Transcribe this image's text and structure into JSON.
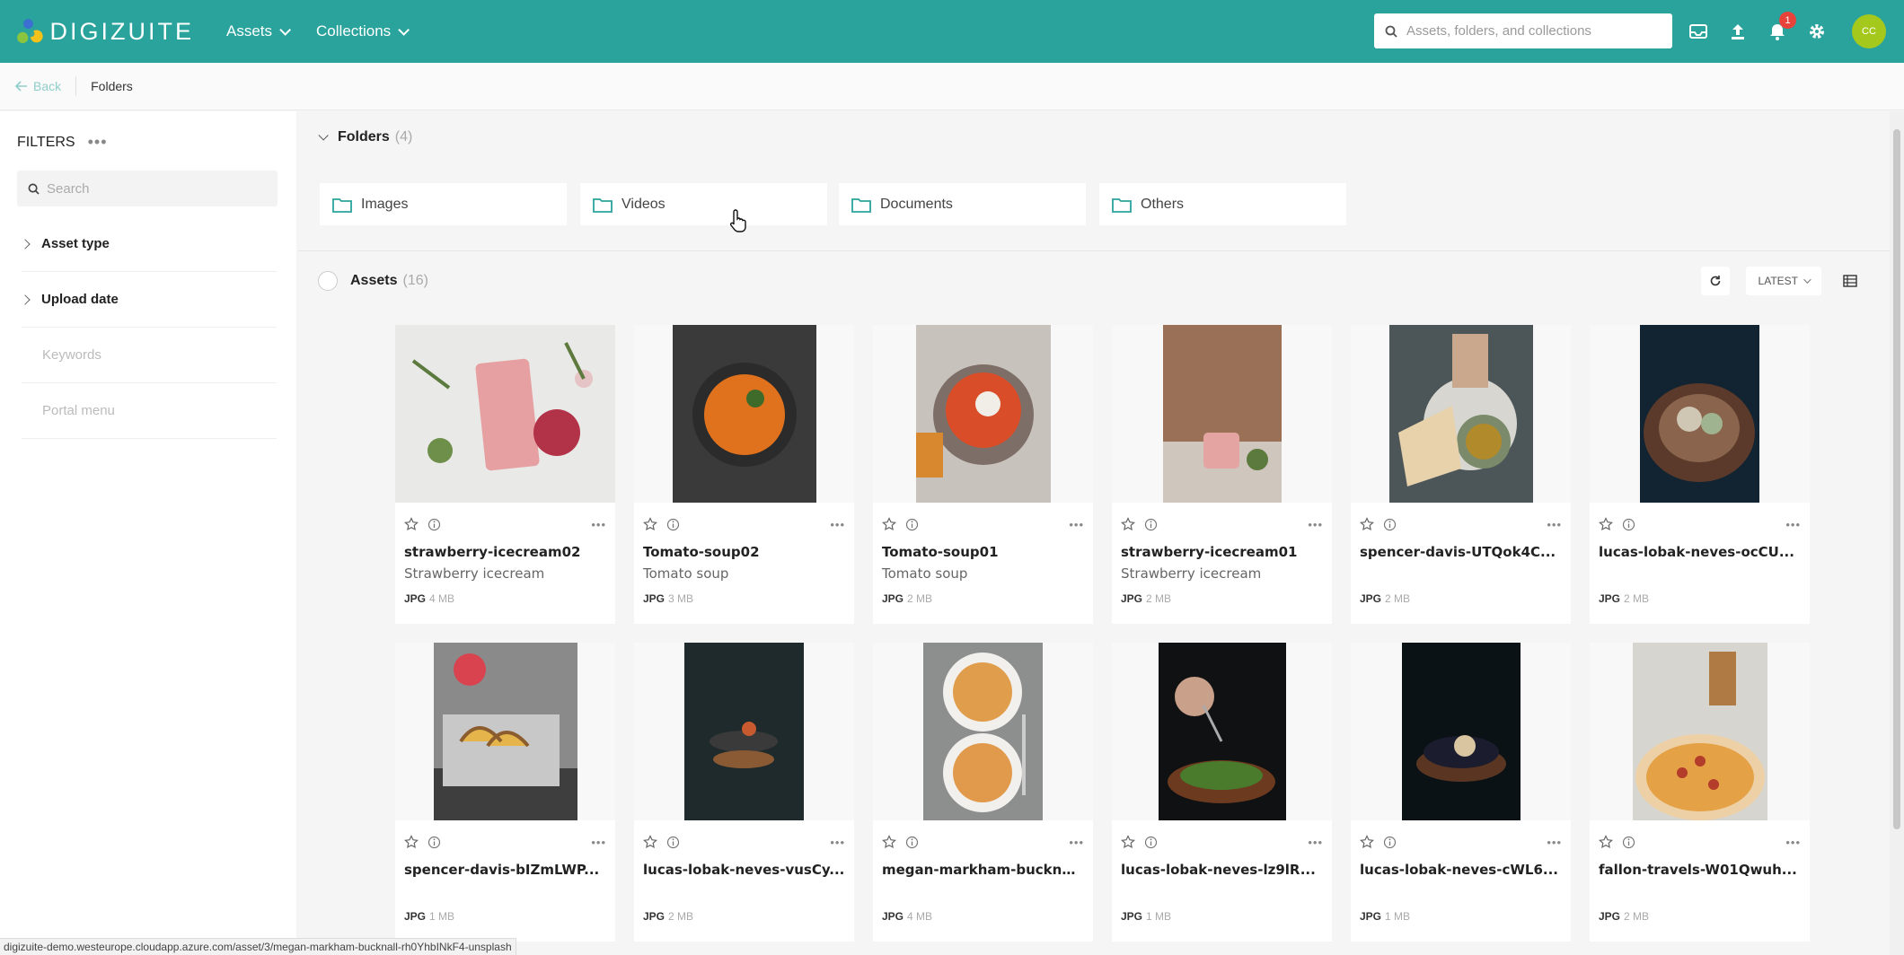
{
  "header": {
    "brand": "DIGIZUITE",
    "nav": [
      {
        "label": "Assets"
      },
      {
        "label": "Collections"
      }
    ],
    "search_placeholder": "Assets, folders, and collections",
    "notification_count": "1",
    "avatar_initials": "CC",
    "accent_color": "#2aa39c"
  },
  "breadcrumb": {
    "back_label": "Back",
    "current": "Folders"
  },
  "sidebar": {
    "title": "FILTERS",
    "search_placeholder": "Search",
    "facets": [
      {
        "label": "Asset type"
      },
      {
        "label": "Upload date"
      },
      {
        "label": "Keywords"
      },
      {
        "label": "Portal menu"
      }
    ]
  },
  "folders": {
    "title": "Folders",
    "count": "(4)",
    "items": [
      {
        "label": "Images"
      },
      {
        "label": "Videos"
      },
      {
        "label": "Documents"
      },
      {
        "label": "Others"
      }
    ]
  },
  "assets": {
    "title": "Assets",
    "count": "(16)",
    "sort_label": "LATEST",
    "items": [
      {
        "title": "strawberry-icecream02",
        "subtitle": "Strawberry icecream",
        "format": "JPG",
        "size": "4 MB"
      },
      {
        "title": "Tomato-soup02",
        "subtitle": "Tomato soup",
        "format": "JPG",
        "size": "3 MB"
      },
      {
        "title": "Tomato-soup01",
        "subtitle": "Tomato soup",
        "format": "JPG",
        "size": "2 MB"
      },
      {
        "title": "strawberry-icecream01",
        "subtitle": "Strawberry icecream",
        "format": "JPG",
        "size": "2 MB"
      },
      {
        "title": "spencer-davis-UTQok4C...",
        "subtitle": "",
        "format": "JPG",
        "size": "2 MB"
      },
      {
        "title": "lucas-lobak-neves-ocCU...",
        "subtitle": "",
        "format": "JPG",
        "size": "2 MB"
      },
      {
        "title": "spencer-davis-bIZmLWP...",
        "subtitle": "",
        "format": "JPG",
        "size": "1 MB"
      },
      {
        "title": "lucas-lobak-neves-vusCy...",
        "subtitle": "",
        "format": "JPG",
        "size": "2 MB"
      },
      {
        "title": "megan-markham-buckna...",
        "subtitle": "",
        "format": "JPG",
        "size": "4 MB"
      },
      {
        "title": "lucas-lobak-neves-lz9lR...",
        "subtitle": "",
        "format": "JPG",
        "size": "1 MB"
      },
      {
        "title": "lucas-lobak-neves-cWL6...",
        "subtitle": "",
        "format": "JPG",
        "size": "1 MB"
      },
      {
        "title": "fallon-travels-W01Qwuh...",
        "subtitle": "",
        "format": "JPG",
        "size": "2 MB"
      }
    ]
  },
  "status_url": "digizuite-demo.westeurope.cloudapp.azure.com/asset/3/megan-markham-bucknall-rh0YhbINkF4-unsplash"
}
